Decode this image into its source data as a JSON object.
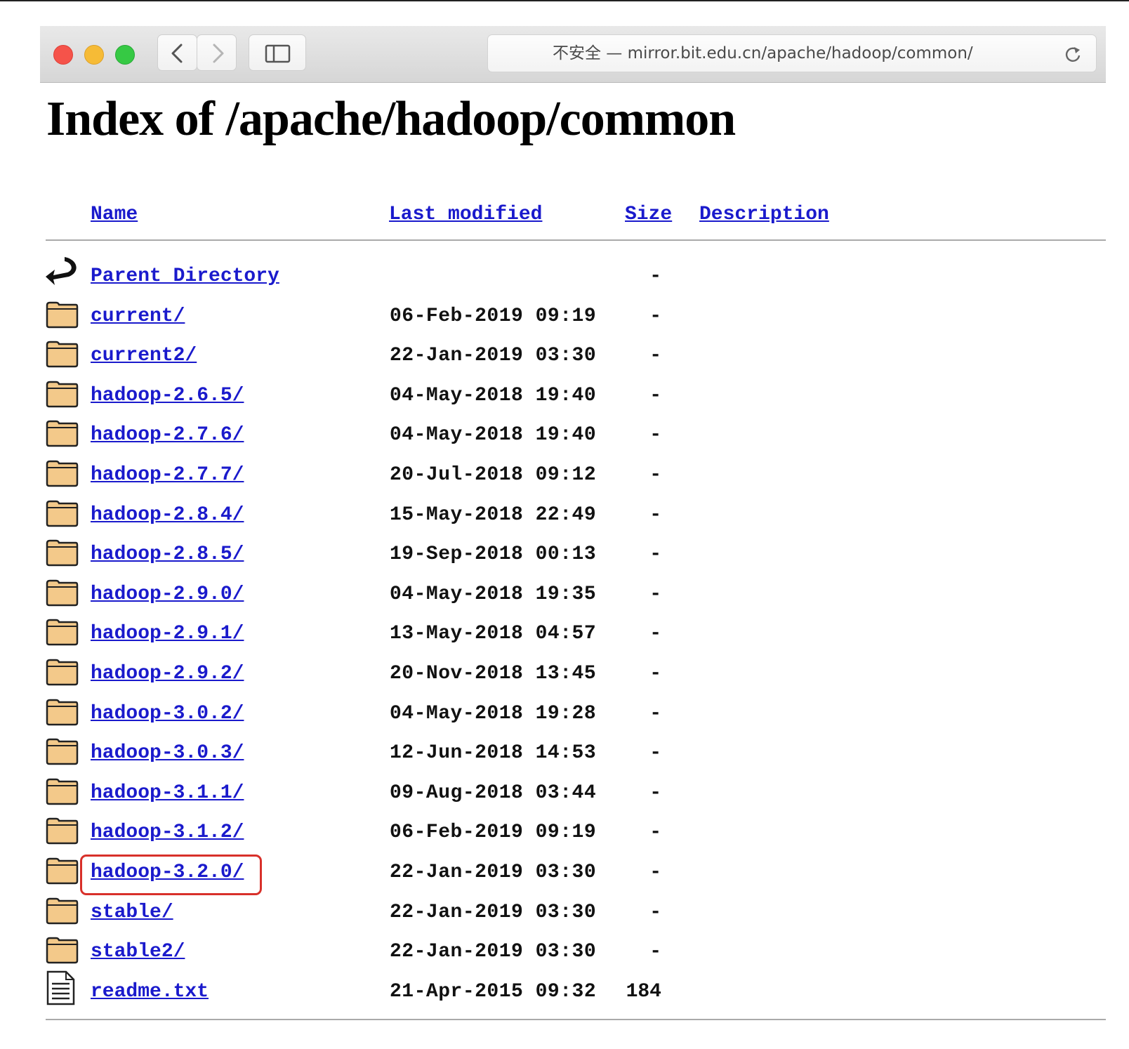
{
  "browser": {
    "address_bar": "不安全 — mirror.bit.edu.cn/apache/hadoop/common/",
    "buttons": [
      "close-dot",
      "minimize-dot",
      "zoom-dot",
      "back-icon",
      "forward-icon",
      "sidebar-icon",
      "reload-icon"
    ],
    "traffic_colors": {
      "close": "#ff5f57",
      "minimize": "#febc2e",
      "zoom": "#28c840"
    }
  },
  "page": {
    "title": "Index of /apache/hadoop/common",
    "columns": {
      "name": "Name",
      "last_modified": "Last modified",
      "size": "Size",
      "description": "Description"
    },
    "link_color": "#1a1acc",
    "highlight_color": "#d8302a",
    "entries": [
      {
        "icon": "back-arrow-icon",
        "name": "Parent Directory",
        "date": "",
        "size": "-"
      },
      {
        "icon": "folder-icon",
        "name": "current/",
        "date": "06-Feb-2019 09:19",
        "size": "-"
      },
      {
        "icon": "folder-icon",
        "name": "current2/",
        "date": "22-Jan-2019 03:30",
        "size": "-"
      },
      {
        "icon": "folder-icon",
        "name": "hadoop-2.6.5/",
        "date": "04-May-2018 19:40",
        "size": "-"
      },
      {
        "icon": "folder-icon",
        "name": "hadoop-2.7.6/",
        "date": "04-May-2018 19:40",
        "size": "-"
      },
      {
        "icon": "folder-icon",
        "name": "hadoop-2.7.7/",
        "date": "20-Jul-2018 09:12",
        "size": "-"
      },
      {
        "icon": "folder-icon",
        "name": "hadoop-2.8.4/",
        "date": "15-May-2018 22:49",
        "size": "-"
      },
      {
        "icon": "folder-icon",
        "name": "hadoop-2.8.5/",
        "date": "19-Sep-2018 00:13",
        "size": "-"
      },
      {
        "icon": "folder-icon",
        "name": "hadoop-2.9.0/",
        "date": "04-May-2018 19:35",
        "size": "-"
      },
      {
        "icon": "folder-icon",
        "name": "hadoop-2.9.1/",
        "date": "13-May-2018 04:57",
        "size": "-"
      },
      {
        "icon": "folder-icon",
        "name": "hadoop-2.9.2/",
        "date": "20-Nov-2018 13:45",
        "size": "-"
      },
      {
        "icon": "folder-icon",
        "name": "hadoop-3.0.2/",
        "date": "04-May-2018 19:28",
        "size": "-"
      },
      {
        "icon": "folder-icon",
        "name": "hadoop-3.0.3/",
        "date": "12-Jun-2018 14:53",
        "size": "-"
      },
      {
        "icon": "folder-icon",
        "name": "hadoop-3.1.1/",
        "date": "09-Aug-2018 03:44",
        "size": "-"
      },
      {
        "icon": "folder-icon",
        "name": "hadoop-3.1.2/",
        "date": "06-Feb-2019 09:19",
        "size": "-"
      },
      {
        "icon": "folder-icon",
        "name": "hadoop-3.2.0/",
        "date": "22-Jan-2019 03:30",
        "size": "-",
        "highlighted": true
      },
      {
        "icon": "folder-icon",
        "name": "stable/",
        "date": "22-Jan-2019 03:30",
        "size": "-"
      },
      {
        "icon": "folder-icon",
        "name": "stable2/",
        "date": "22-Jan-2019 03:30",
        "size": "-"
      },
      {
        "icon": "text-file-icon",
        "name": "readme.txt",
        "date": "21-Apr-2015 09:32",
        "size": "184"
      }
    ]
  }
}
